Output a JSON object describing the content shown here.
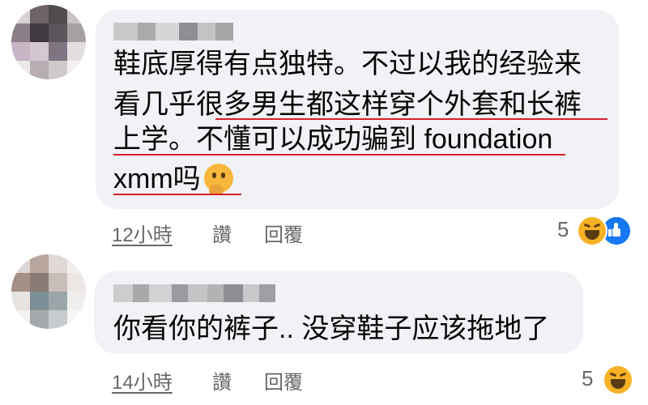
{
  "comments": [
    {
      "lines": [
        "鞋底厚得有点独特。不过以我的经验来",
        "看几乎很多男生都这样穿个外套和长裤",
        "上学。不懂可以成功骗到 foundation",
        "xmm吗"
      ],
      "trailing_emoji": "thinking-face",
      "time": "12小時",
      "like_label": "讚",
      "reply_label": "回覆",
      "reaction_count": "5",
      "reactions": [
        "haha",
        "like"
      ]
    },
    {
      "lines": [
        "你看你的裤子.. 没穿鞋子应该拖地了"
      ],
      "time": "14小時",
      "like_label": "讚",
      "reply_label": "回覆",
      "reaction_count": "5",
      "reactions": [
        "haha"
      ]
    }
  ],
  "colors": {
    "bubble": "#f0f2f5",
    "text": "#050505",
    "meta": "#65676b",
    "underline": "#d8202a",
    "like_blue": "#1877f2",
    "haha_yellow": "#f7b125"
  }
}
